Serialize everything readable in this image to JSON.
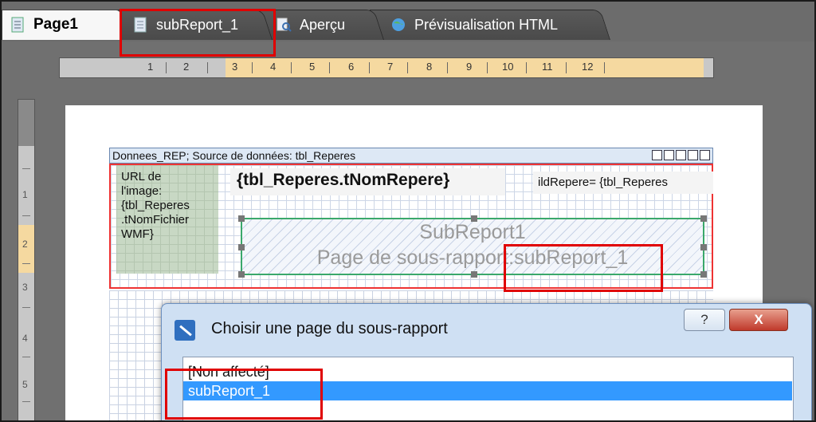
{
  "tabs": [
    {
      "label": "Page1",
      "icon": "page-icon",
      "active": true
    },
    {
      "label": "subReport_1",
      "icon": "page-icon",
      "active": false
    },
    {
      "label": "Aperçu",
      "icon": "preview-icon",
      "active": false
    },
    {
      "label": "Prévisualisation HTML",
      "icon": "globe-icon",
      "active": false
    }
  ],
  "ruler": {
    "horizontal": [
      "1",
      "2",
      "3",
      "4",
      "5",
      "6",
      "7",
      "8",
      "9",
      "10",
      "11",
      "12"
    ],
    "vertical": [
      "1",
      "2",
      "3",
      "4",
      "5"
    ]
  },
  "report": {
    "section_header": "Donnees_REP; Source de données: tbl_Reperes",
    "image_field": "URL de\nl'image:\n{tbl_Reperes\n.tNomFichier\nWMF}",
    "title_field": "{tbl_Reperes.tNomRepere}",
    "link_field": "ildRepere= {tbl_Reperes",
    "subreport": {
      "name": "SubReport1",
      "page_label": "Page de sous-rapport:subReport_1"
    }
  },
  "dialog": {
    "title": "Choisir une page du sous-rapport",
    "help_label": "?",
    "close_label": "X",
    "options": [
      "[Non affecté]",
      "subReport_1"
    ],
    "selected": "subReport_1"
  },
  "colors": {
    "highlight": "#e00000",
    "selection": "#3399ff",
    "ruler_active": "#f5d9a0"
  }
}
